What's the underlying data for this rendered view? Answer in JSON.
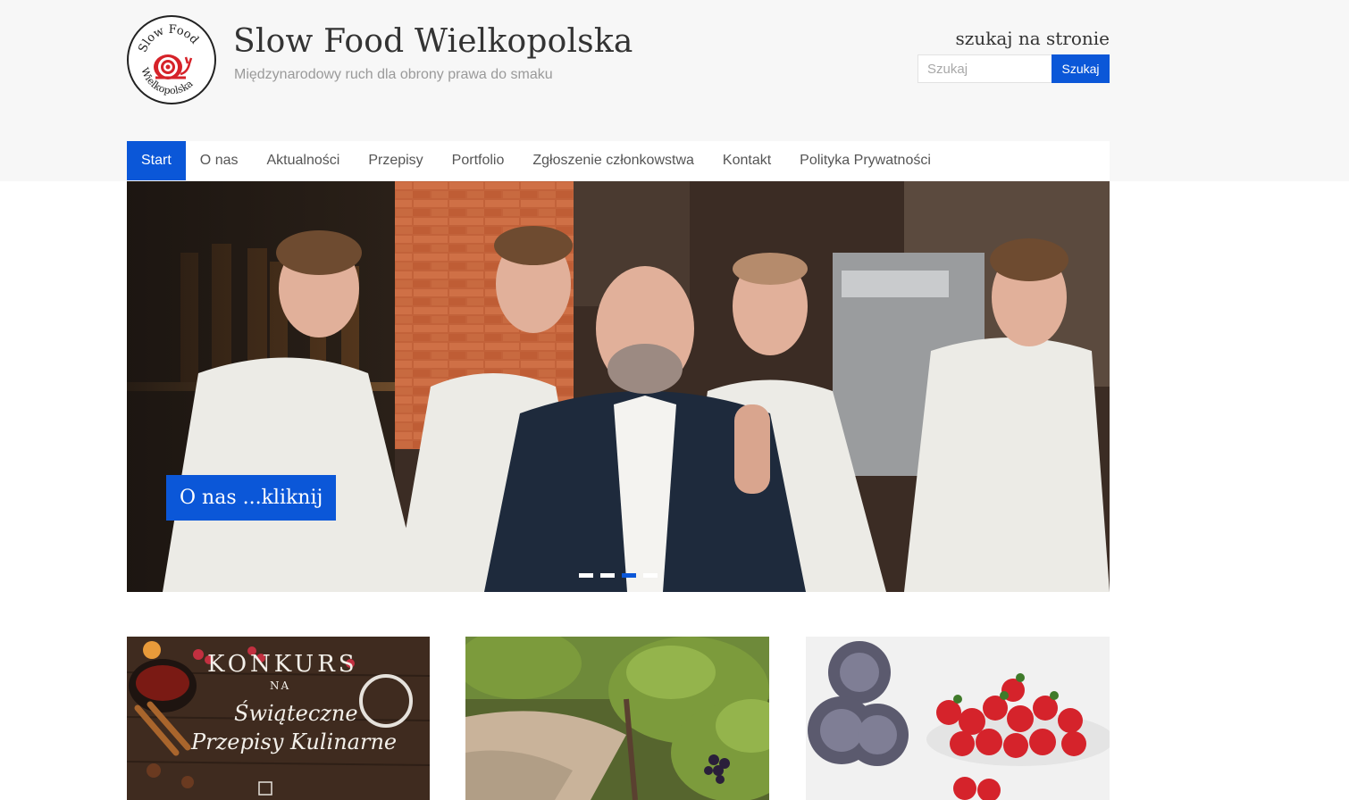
{
  "header": {
    "logo_alt": "Slow Food Wielkopolska",
    "logo_text_top": "Slow Food",
    "logo_text_bottom": "Wielkopolska",
    "title": "Slow Food Wielkopolska",
    "tagline": "Międzynarodowy ruch dla obrony prawa do smaku"
  },
  "search": {
    "heading": "szukaj na stronie",
    "placeholder": "Szukaj",
    "button_label": "Szukaj"
  },
  "nav": {
    "items": [
      {
        "label": "Start",
        "active": true
      },
      {
        "label": "O nas"
      },
      {
        "label": "Aktualności"
      },
      {
        "label": "Przepisy"
      },
      {
        "label": "Portfolio"
      },
      {
        "label": "Zgłoszenie członkowstwa"
      },
      {
        "label": "Kontakt"
      },
      {
        "label": "Polityka Prywatności"
      }
    ]
  },
  "hero": {
    "caption": "O nas ...kliknij",
    "slide_count": 4,
    "active_slide": 3
  },
  "cards": [
    {
      "konkurs_title": "KONKURS",
      "konkurs_na": "NA",
      "konkurs_line1": "Świąteczne",
      "konkurs_line2": "Przepisy Kulinarne"
    },
    {},
    {}
  ],
  "colors": {
    "accent": "#0b57d8",
    "header_bg": "#f7f7f7"
  }
}
